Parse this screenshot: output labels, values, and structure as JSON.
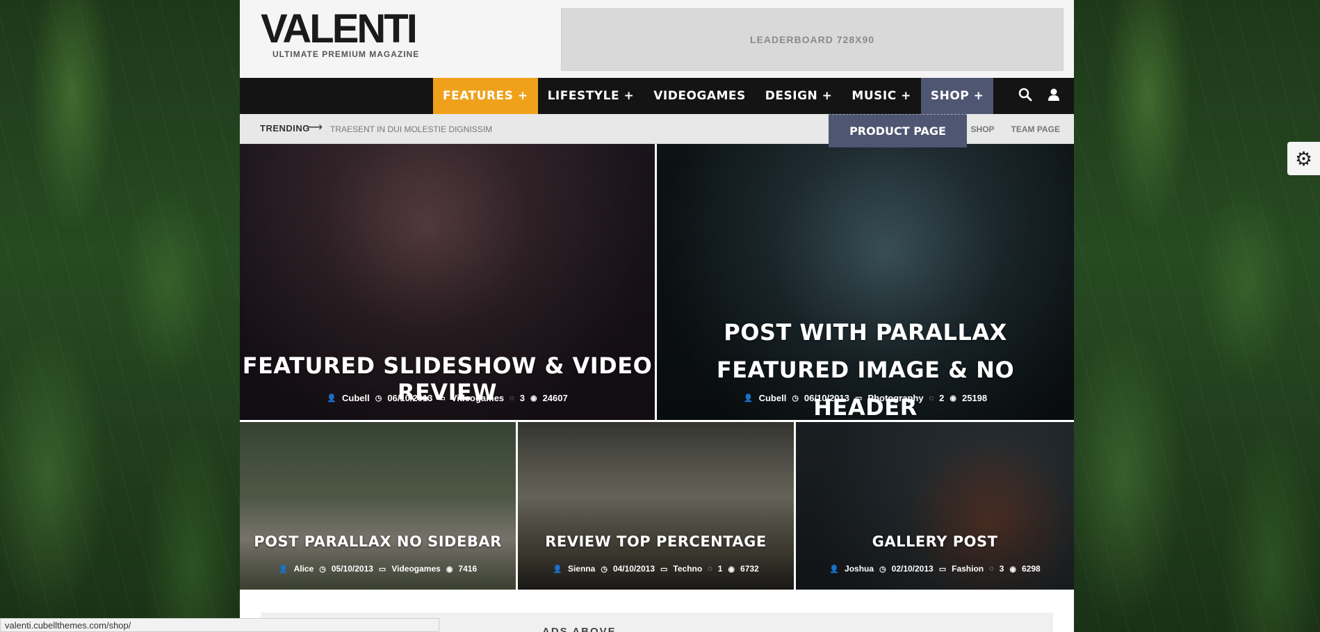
{
  "header": {
    "logo": "VALENTI",
    "tagline": "ULTIMATE PREMIUM MAGAZINE",
    "ad": "LEADERBOARD 728X90"
  },
  "nav": {
    "items": [
      {
        "label": "FEATURES +"
      },
      {
        "label": "LIFESTYLE +"
      },
      {
        "label": "VIDEOGAMES"
      },
      {
        "label": "DESIGN +"
      },
      {
        "label": "MUSIC +"
      },
      {
        "label": "SHOP +"
      }
    ],
    "dropdown": "PRODUCT PAGE",
    "icons": [
      "search-icon",
      "user-icon"
    ]
  },
  "trending": {
    "label": "TRENDING",
    "text": "TRAESENT IN DUI MOLESTIE DIGNISSIM",
    "links": [
      "SHOP",
      "TEAM PAGE"
    ]
  },
  "posts": [
    {
      "title": "FEATURED SLIDESHOW & VIDEO REVIEW",
      "author": "Cubell",
      "date": "06/10/2013",
      "category": "Videogames",
      "comments": "3",
      "views": "24607"
    },
    {
      "title": "POST WITH PARALLAX FEATURED IMAGE & NO HEADER",
      "author": "Cubell",
      "date": "06/10/2013",
      "category": "Photography",
      "comments": "2",
      "views": "25198"
    },
    {
      "title": "POST PARALLAX NO SIDEBAR",
      "author": "Alice",
      "date": "05/10/2013",
      "category": "Videogames",
      "comments": "",
      "views": "7416"
    },
    {
      "title": "REVIEW TOP PERCENTAGE",
      "author": "Sienna",
      "date": "04/10/2013",
      "category": "Techno",
      "comments": "1",
      "views": "6732"
    },
    {
      "title": "GALLERY POST",
      "author": "Joshua",
      "date": "02/10/2013",
      "category": "Fashion",
      "comments": "3",
      "views": "6298"
    }
  ],
  "bottom": {
    "text": "ADS ABOVE"
  },
  "status_url": "valenti.cubellthemes.com/shop/",
  "colors": {
    "accent": "#f0a11c",
    "shop": "#4f5672",
    "nav": "#141414"
  }
}
